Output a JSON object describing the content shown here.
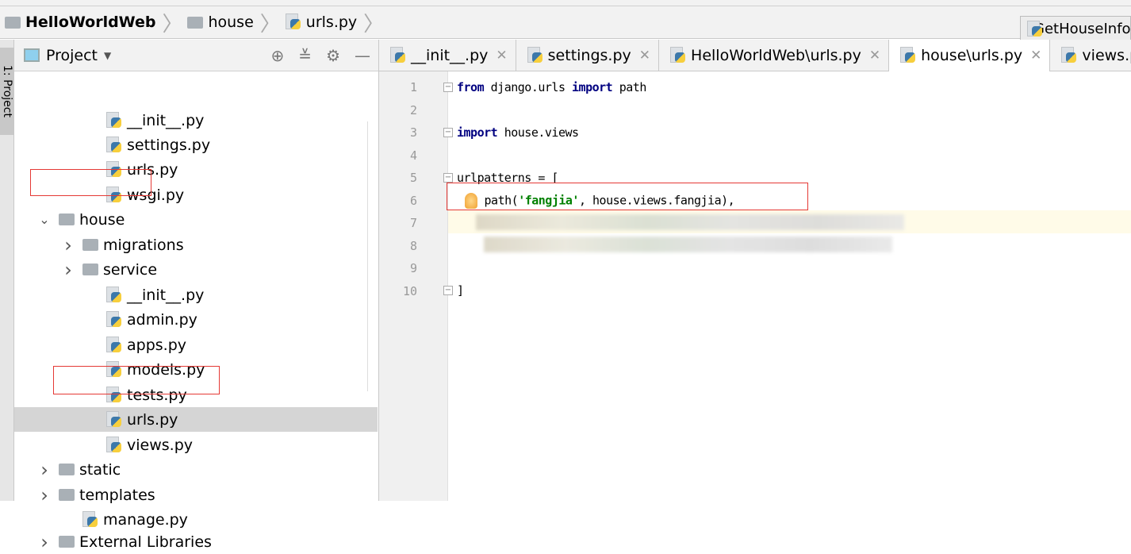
{
  "breadcrumb": [
    "HelloWorldWeb",
    "house",
    "urls.py"
  ],
  "run_config": "GetHouseInfo",
  "left_strip": {
    "label": "1: Project"
  },
  "project_panel": {
    "title": "Project",
    "tree": [
      {
        "label": "__init__.py",
        "type": "py",
        "level": 2
      },
      {
        "label": "settings.py",
        "type": "py",
        "level": 2
      },
      {
        "label": "urls.py",
        "type": "py",
        "level": 2
      },
      {
        "label": "wsgi.py",
        "type": "py",
        "level": 2
      },
      {
        "label": "house",
        "type": "folder",
        "level": 1,
        "expanded": true
      },
      {
        "label": "migrations",
        "type": "folder",
        "level": 2,
        "expanded": false
      },
      {
        "label": "service",
        "type": "folder",
        "level": 2,
        "expanded": false
      },
      {
        "label": "__init__.py",
        "type": "py",
        "level": 2
      },
      {
        "label": "admin.py",
        "type": "py",
        "level": 2
      },
      {
        "label": "apps.py",
        "type": "py",
        "level": 2
      },
      {
        "label": "models.py",
        "type": "py",
        "level": 2
      },
      {
        "label": "tests.py",
        "type": "py",
        "level": 2
      },
      {
        "label": "urls.py",
        "type": "py",
        "level": 2,
        "selected": true
      },
      {
        "label": "views.py",
        "type": "py",
        "level": 2
      },
      {
        "label": "static",
        "type": "folder",
        "level": 1,
        "expanded": false
      },
      {
        "label": "templates",
        "type": "folder",
        "level": 1,
        "expanded": false
      },
      {
        "label": "manage.py",
        "type": "py",
        "level": 1
      },
      {
        "label": "External Libraries",
        "type": "lib",
        "level": 0,
        "expanded": false
      }
    ]
  },
  "editor": {
    "tabs": [
      {
        "label": "__init__.py",
        "active": false
      },
      {
        "label": "settings.py",
        "active": false
      },
      {
        "label": "HelloWorldWeb\\urls.py",
        "active": false
      },
      {
        "label": "house\\urls.py",
        "active": true
      },
      {
        "label": "views.py",
        "active": false
      }
    ],
    "line_numbers": [
      "1",
      "2",
      "3",
      "4",
      "5",
      "6",
      "7",
      "8",
      "9",
      "10"
    ],
    "code": {
      "l1_kw1": "from",
      "l1_mid": " django.urls ",
      "l1_kw2": "import",
      "l1_end": " path",
      "l3_kw": "import",
      "l3_end": " house.views",
      "l5": "urlpatterns = [",
      "l6_a": "path(",
      "l6_str": "'fangjia'",
      "l6_b": ", house.views.fangjia),",
      "l10": "]"
    }
  }
}
